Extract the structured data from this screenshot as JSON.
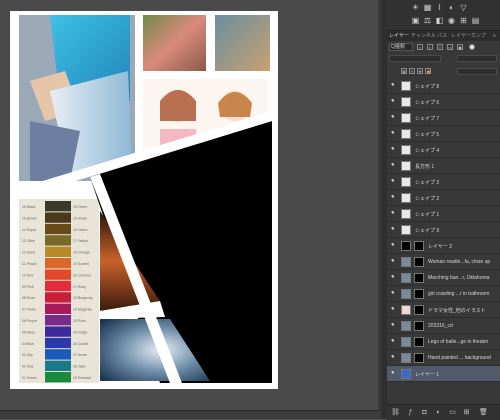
{
  "colors": {
    "workspace": "#4a4a4a",
    "panel": "#383838",
    "selected_layer": "#505a6a",
    "document_bg": "#ffffff"
  },
  "panel": {
    "tabs": [
      {
        "label": "レイヤー",
        "active": true
      },
      {
        "label": "チャンネル",
        "active": false
      },
      {
        "label": "パス",
        "active": false
      },
      {
        "label": "レイヤーカンプ",
        "active": false
      }
    ],
    "filter": {
      "label": "Q種類"
    },
    "layers": [
      {
        "name": "シェイプ 8",
        "eye": "●",
        "thumb": "shape"
      },
      {
        "name": "シェイプ 6",
        "eye": "●",
        "thumb": "shape"
      },
      {
        "name": "シェイプ 7",
        "eye": "●",
        "thumb": "shape"
      },
      {
        "name": "シェイプ 5",
        "eye": "●",
        "thumb": "shape"
      },
      {
        "name": "シェイプ 4",
        "eye": "●",
        "thumb": "shape"
      },
      {
        "name": "長方形 1",
        "eye": "●",
        "thumb": "shape"
      },
      {
        "name": "シェイプ 3",
        "eye": "●",
        "thumb": "shape"
      },
      {
        "name": "シェイプ 2",
        "eye": "●",
        "thumb": "shape"
      },
      {
        "name": "シェイプ 1",
        "eye": "●",
        "thumb": "shape"
      },
      {
        "name": "シェイプ 9",
        "eye": "●",
        "thumb": "shape"
      },
      {
        "name": "レイヤー 2",
        "eye": "●",
        "thumb": "black",
        "mask": true
      },
      {
        "name": "Woman readin...fa, close up",
        "eye": "●",
        "thumb": "photo",
        "mask": true
      },
      {
        "name": "Marching ban...r, Oklahoma",
        "eye": "●",
        "thumb": "photo",
        "mask": true
      },
      {
        "name": "girl crawling ...r in bathroom",
        "eye": "●",
        "thumb": "photo",
        "mask": true
      },
      {
        "name": "ドラマ女性_他のイラスト",
        "eye": "●",
        "thumb": "illus",
        "mask": true
      },
      {
        "name": "203316_cd",
        "eye": "●",
        "thumb": "photo",
        "mask": true
      },
      {
        "name": "Legs of balle...ge in theater",
        "eye": "●",
        "thumb": "photo",
        "mask": true
      },
      {
        "name": "Hand painted ... background",
        "eye": "●",
        "thumb": "photo",
        "mask": true
      },
      {
        "name": "レイヤー 1",
        "eye": "●",
        "thumb": "color",
        "selected": true
      }
    ]
  },
  "document": {
    "swatch_labels_left": [
      "15 Black",
      "15 Brown",
      "14 Sepia",
      "13 Olive",
      "12 Sand",
      "11 Peach",
      "10 Red",
      "09 Pink",
      "08 Rose",
      "07 Violet",
      "06 Purple",
      "05 Navy",
      "04 Blue",
      "03 Sky",
      "02 Teal",
      "01 Green"
    ],
    "swatch_labels_right": [
      "15 Ochre",
      "15 Khaki",
      "16 Ochre",
      "17 Yellow",
      "18 Orange",
      "19 Scarlet",
      "20 Crimson",
      "21 Ruby",
      "22 Burgundy",
      "23 Magenta",
      "24 Plum",
      "25 Indigo",
      "26 Cobalt",
      "27 Azure",
      "28 Jade",
      "29 Emerald"
    ]
  }
}
